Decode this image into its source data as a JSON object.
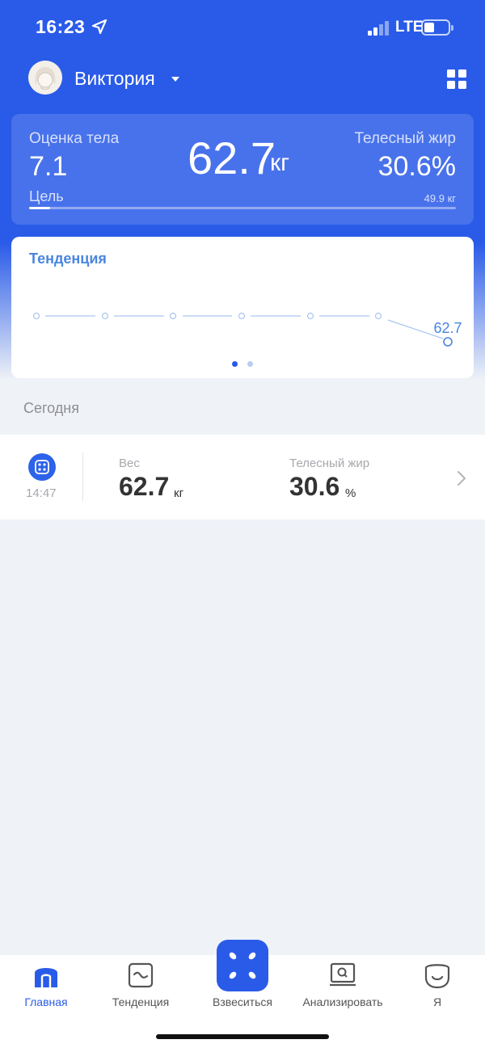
{
  "status_bar": {
    "time": "16:23",
    "network": "LTE"
  },
  "header": {
    "user_name": "Виктория"
  },
  "summary": {
    "score_label": "Оценка тела",
    "score_value": "7.1",
    "weight_value": "62.7",
    "weight_unit": "кг",
    "fat_label": "Телесный жир",
    "fat_value": "30.6%",
    "goal_label": "Цель",
    "goal_value": "49.9 кг",
    "goal_progress": 0.05
  },
  "trend": {
    "title": "Тенденция",
    "last_value_label": "62.7",
    "page_count": 2,
    "active_page": 0
  },
  "today": {
    "label": "Сегодня",
    "record": {
      "time": "14:47",
      "weight_label": "Вес",
      "weight_value": "62.7",
      "weight_unit": "кг",
      "fat_label": "Телесный жир",
      "fat_value": "30.6",
      "fat_unit": "%"
    }
  },
  "tabs": [
    {
      "label": "Главная",
      "icon": "home-icon",
      "active": true
    },
    {
      "label": "Тенденция",
      "icon": "trend-icon",
      "active": false
    },
    {
      "label": "Взвеситься",
      "icon": "scale-icon",
      "active": false
    },
    {
      "label": "Анализировать",
      "icon": "analyze-icon",
      "active": false
    },
    {
      "label": "Я",
      "icon": "profile-icon",
      "active": false
    }
  ],
  "colors": {
    "brand": "#2a5be8",
    "trend_line": "#a9c6f0",
    "trend_label": "#4a86e0"
  }
}
